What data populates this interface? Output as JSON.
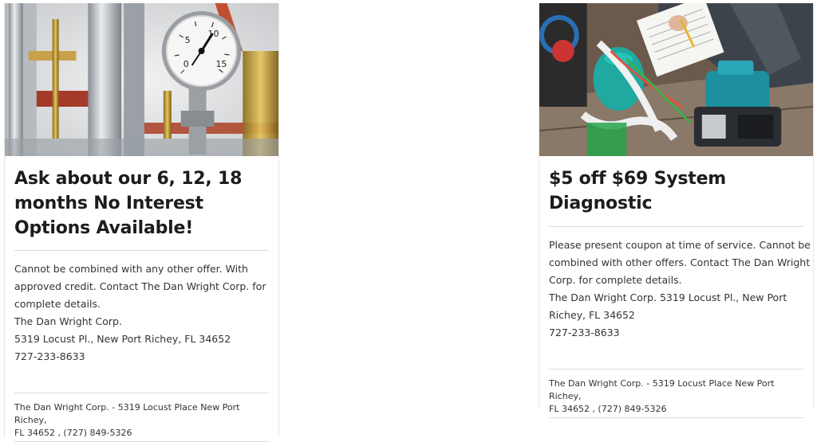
{
  "cards": [
    {
      "title_lines": [
        "Ask about our 6, 12, 18",
        "months No Interest",
        "Options Available!"
      ],
      "desc_lines": [
        "Cannot be combined with any other offer. With",
        "approved credit. Contact The Dan Wright Corp. for",
        "complete details.",
        "The Dan Wright Corp.",
        "5319 Locust Pl., New Port Richey, FL 34652",
        "727-233-8633"
      ],
      "footer_lines": [
        "The Dan Wright Corp. - 5319 Locust Place New Port Richey,",
        "FL 34652 , (727) 849-5326"
      ],
      "gauge_labels": [
        "5",
        "10",
        "0",
        "15"
      ]
    },
    {
      "title_lines": [
        "$5 off $69 System",
        "Diagnostic"
      ],
      "desc_lines": [
        "Please present coupon at time of service. Cannot be",
        "combined with other offers. Contact The Dan Wright",
        "Corp. for complete details.",
        "The Dan Wright Corp. 5319 Locust Pl., New Port",
        "Richey, FL 34652",
        "727-233-8633"
      ],
      "footer_lines": [
        "The Dan Wright Corp. - 5319 Locust Place New Port Richey,",
        "FL 34652 , (727) 849-5326"
      ]
    }
  ]
}
